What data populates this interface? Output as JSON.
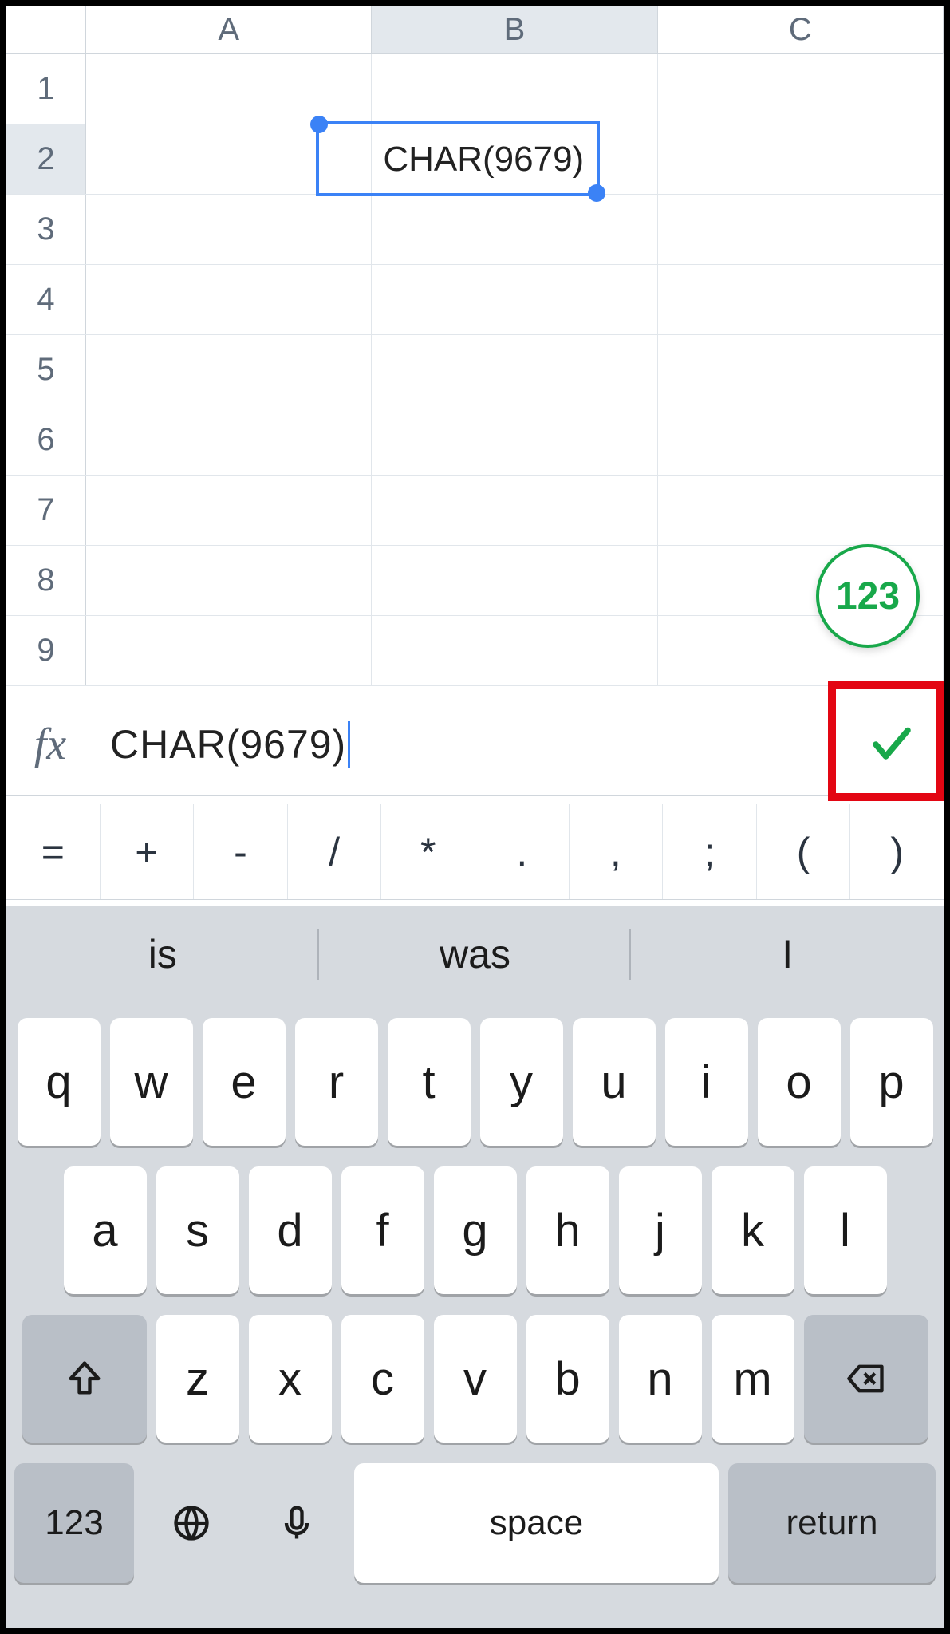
{
  "spreadsheet": {
    "columns": [
      "A",
      "B",
      "C"
    ],
    "rows": [
      "1",
      "2",
      "3",
      "4",
      "5",
      "6",
      "7",
      "8",
      "9"
    ],
    "selected_cell": "B2",
    "selected_column_index": 1,
    "selected_row_index": 1,
    "cell_B2_value": "CHAR(9679)"
  },
  "numeric_button": {
    "label": "123"
  },
  "formula_bar": {
    "fx_symbol": "fx",
    "value": "CHAR(9679)"
  },
  "operator_row": [
    "=",
    "+",
    "-",
    "/",
    "*",
    ".",
    ",",
    ";",
    "(",
    ")"
  ],
  "suggestions": [
    "is",
    "was",
    "I"
  ],
  "keyboard": {
    "row1": [
      "q",
      "w",
      "e",
      "r",
      "t",
      "y",
      "u",
      "i",
      "o",
      "p"
    ],
    "row2": [
      "a",
      "s",
      "d",
      "f",
      "g",
      "h",
      "j",
      "k",
      "l"
    ],
    "row3": [
      "z",
      "x",
      "c",
      "v",
      "b",
      "n",
      "m"
    ],
    "num_key": "123",
    "space_key": "space",
    "return_key": "return"
  }
}
